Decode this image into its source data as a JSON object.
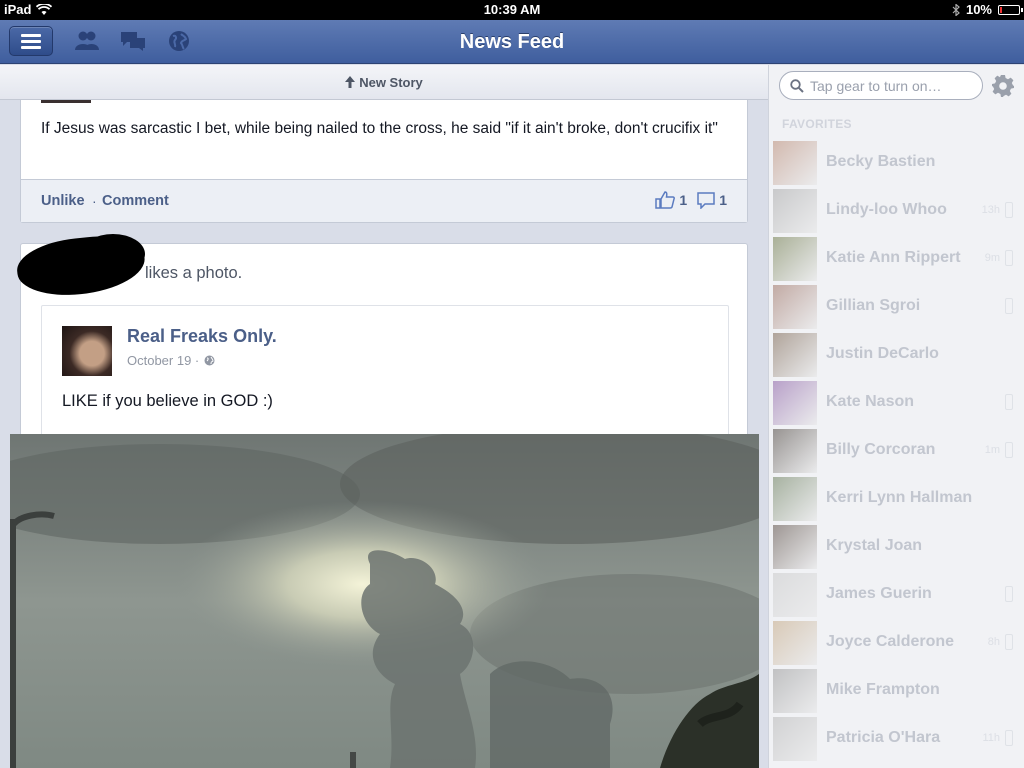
{
  "status_bar": {
    "device": "iPad",
    "time": "10:39 AM",
    "battery": "10%",
    "battery_level": 0.1
  },
  "nav": {
    "title": "News Feed",
    "icons": [
      "menu-icon",
      "friend-requests-icon",
      "messages-icon",
      "notifications-globe-icon"
    ]
  },
  "feed": {
    "new_story_label": "New Story",
    "post1": {
      "text": "If Jesus was sarcastic I bet, while being nailed to the cross, he said \"if it ain't broke, don't crucifix it\"",
      "unlike_label": "Unlike",
      "separator": "·",
      "comment_label": "Comment",
      "like_count": "1",
      "comment_count": "1"
    },
    "post2": {
      "activity_text": "likes a photo.",
      "shared": {
        "page_name": "Real Freaks Only.",
        "date": "October 19 ·",
        "text": "LIKE if you believe in GOD :)"
      }
    }
  },
  "sidebar": {
    "search_placeholder": "Tap gear to turn on…",
    "favorites_header": "FAVORITES",
    "friends": [
      {
        "name": "Becky Bastien",
        "time": "",
        "mobile": false,
        "color": "#b98a74"
      },
      {
        "name": "Lindy-loo Whoo",
        "time": "13h",
        "mobile": true,
        "color": "#a8a8a8"
      },
      {
        "name": "Katie Ann Rippert",
        "time": "9m",
        "mobile": true,
        "color": "#6f7a4a"
      },
      {
        "name": "Gillian Sgroi",
        "time": "",
        "mobile": true,
        "color": "#9c7062"
      },
      {
        "name": "Justin DeCarlo",
        "time": "",
        "mobile": false,
        "color": "#7b6450"
      },
      {
        "name": "Kate Nason",
        "time": "",
        "mobile": true,
        "color": "#8a5ea5"
      },
      {
        "name": "Billy Corcoran",
        "time": "1m",
        "mobile": true,
        "color": "#4e4640"
      },
      {
        "name": "Kerri Lynn Hallman",
        "time": "",
        "mobile": false,
        "color": "#6a7d5b"
      },
      {
        "name": "Krystal Joan",
        "time": "",
        "mobile": false,
        "color": "#5a4c44"
      },
      {
        "name": "James Guerin",
        "time": "",
        "mobile": true,
        "color": "#c9c9c9"
      },
      {
        "name": "Joyce Calderone",
        "time": "8h",
        "mobile": true,
        "color": "#c4a884"
      },
      {
        "name": "Mike Frampton",
        "time": "",
        "mobile": false,
        "color": "#9a9a9a"
      },
      {
        "name": "Patricia O'Hara",
        "time": "11h",
        "mobile": true,
        "color": "#b7b7b7"
      }
    ]
  }
}
